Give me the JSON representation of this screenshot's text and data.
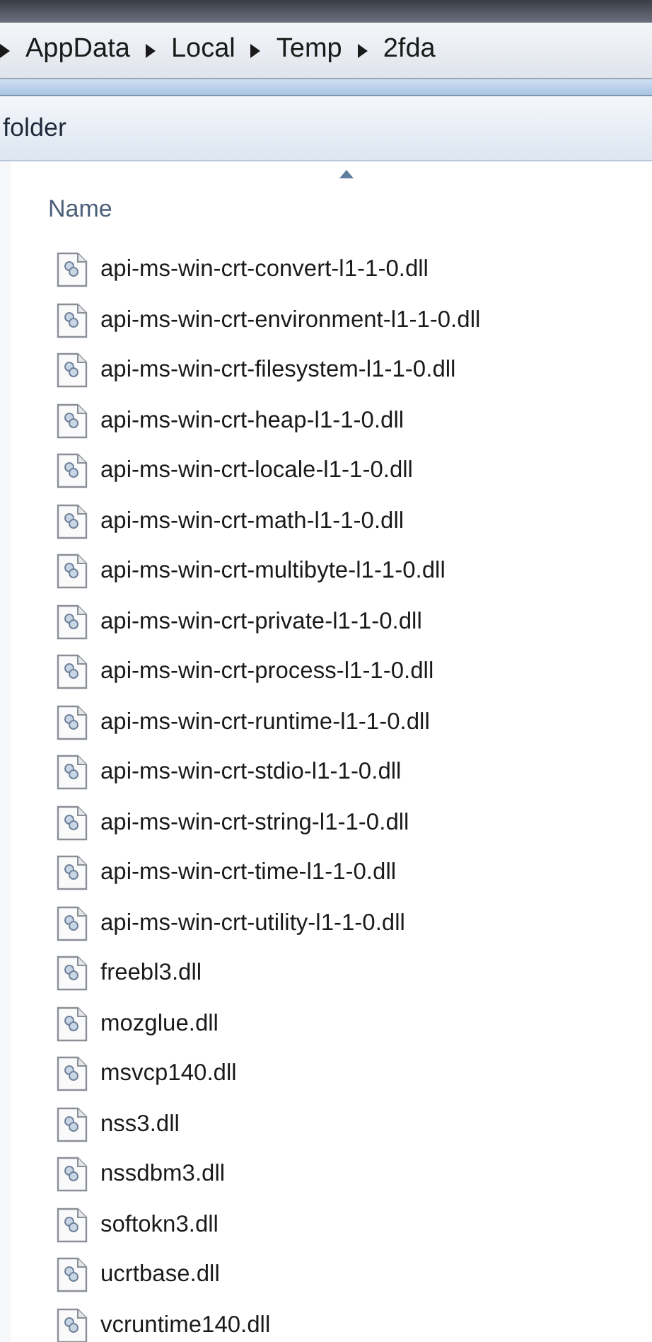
{
  "breadcrumb": [
    "AppData",
    "Local",
    "Temp",
    "2fda"
  ],
  "toolbar": {
    "label": "folder"
  },
  "columns": [
    {
      "label": "Name",
      "sorted": true
    }
  ],
  "files": [
    {
      "name": "api-ms-win-crt-convert-l1-1-0.dll"
    },
    {
      "name": "api-ms-win-crt-environment-l1-1-0.dll"
    },
    {
      "name": "api-ms-win-crt-filesystem-l1-1-0.dll"
    },
    {
      "name": "api-ms-win-crt-heap-l1-1-0.dll"
    },
    {
      "name": "api-ms-win-crt-locale-l1-1-0.dll"
    },
    {
      "name": "api-ms-win-crt-math-l1-1-0.dll"
    },
    {
      "name": "api-ms-win-crt-multibyte-l1-1-0.dll"
    },
    {
      "name": "api-ms-win-crt-private-l1-1-0.dll"
    },
    {
      "name": "api-ms-win-crt-process-l1-1-0.dll"
    },
    {
      "name": "api-ms-win-crt-runtime-l1-1-0.dll"
    },
    {
      "name": "api-ms-win-crt-stdio-l1-1-0.dll"
    },
    {
      "name": "api-ms-win-crt-string-l1-1-0.dll"
    },
    {
      "name": "api-ms-win-crt-time-l1-1-0.dll"
    },
    {
      "name": "api-ms-win-crt-utility-l1-1-0.dll"
    },
    {
      "name": "freebl3.dll"
    },
    {
      "name": "mozglue.dll"
    },
    {
      "name": "msvcp140.dll"
    },
    {
      "name": "nss3.dll"
    },
    {
      "name": "nssdbm3.dll"
    },
    {
      "name": "softokn3.dll"
    },
    {
      "name": "ucrtbase.dll"
    },
    {
      "name": "vcruntime140.dll"
    }
  ]
}
